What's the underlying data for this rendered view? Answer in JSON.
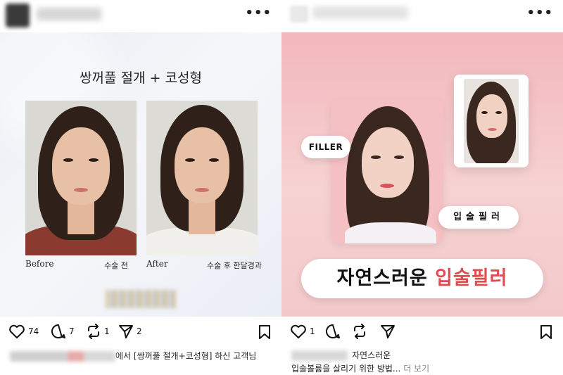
{
  "left_post": {
    "headline": "쌍꺼풀 절개 + 코성형",
    "before_label": "Before",
    "before_caption": "수술 전",
    "after_label": "After",
    "after_caption": "수술 후 한달경과",
    "likes": "74",
    "comments": "7",
    "reposts": "1",
    "shares": "2",
    "caption_text": "에서 [쌍꺼풀 절개+코성형] 하신 고객님"
  },
  "right_post": {
    "filler_tag": "FILLER",
    "lip_tag": "입술필러",
    "headline_main": "자연스러운 ",
    "headline_accent": "입술필러",
    "likes": "1",
    "caption_line1": "자연스러운",
    "caption_line2": "입술볼륨을 살리기 위한 방법...",
    "more_label": "더 보기"
  },
  "icons": {
    "more": "more-horizontal-icon",
    "like": "heart-icon",
    "comment": "comment-icon",
    "repost": "repost-icon",
    "share": "send-icon",
    "save": "bookmark-icon"
  },
  "colors": {
    "accent_red": "#e04b50",
    "pink_bg": "#f2b7bc"
  }
}
